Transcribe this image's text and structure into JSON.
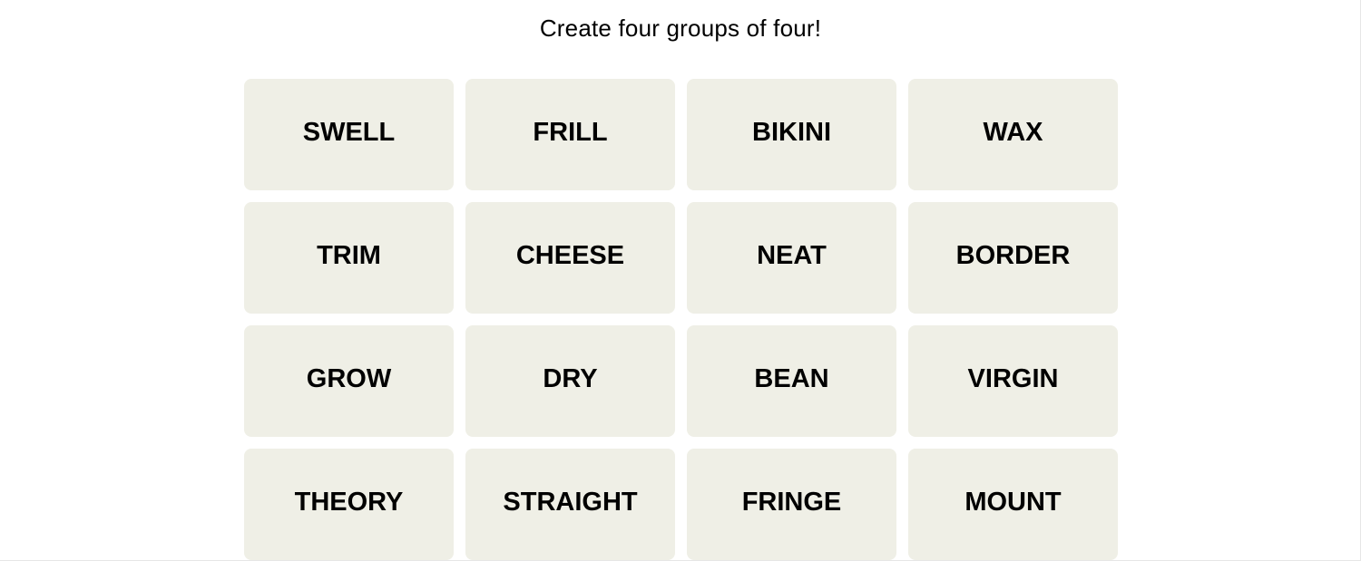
{
  "game": {
    "prompt": "Create four groups of four!",
    "tile_color": "#efefe6",
    "tiles": [
      "SWELL",
      "FRILL",
      "BIKINI",
      "WAX",
      "TRIM",
      "CHEESE",
      "NEAT",
      "BORDER",
      "GROW",
      "DRY",
      "BEAN",
      "VIRGIN",
      "THEORY",
      "STRAIGHT",
      "FRINGE",
      "MOUNT"
    ]
  }
}
